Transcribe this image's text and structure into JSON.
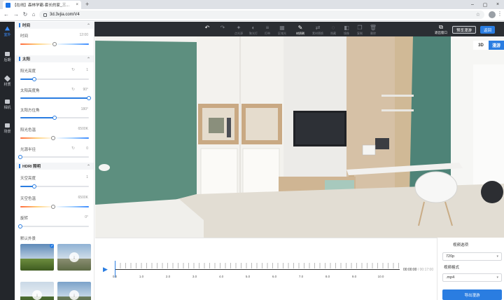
{
  "browser": {
    "tab_title": "【在线】森林学霸-套长的家_三...",
    "url": "3d.3vjia.com/V4",
    "new_tab": "+"
  },
  "sidenav": {
    "items": [
      {
        "label": "室外",
        "icon": "house-icon",
        "active": true
      },
      {
        "label": "后期",
        "icon": "sliders-icon",
        "active": false
      },
      {
        "label": "材质",
        "icon": "cube-icon",
        "active": false
      },
      {
        "label": "相机",
        "icon": "camera-icon",
        "active": false
      },
      {
        "label": "场景",
        "icon": "scene-icon",
        "active": false
      }
    ]
  },
  "panel": {
    "sec_time": "时间",
    "time_label": "时间",
    "time_value": "12:00",
    "time_fraction": 0.5,
    "sec_sun": "太阳",
    "sun_brightness_label": "阳光亮度",
    "sun_brightness_value": "1",
    "sun_brightness_fraction": 0.2,
    "sun_altitude_label": "太阳高度角",
    "sun_altitude_value": "90°",
    "sun_altitude_fraction": 1.0,
    "sun_azimuth_label": "太阳方位角",
    "sun_azimuth_value": "180°",
    "sun_azimuth_fraction": 0.5,
    "sun_color_label": "阳光色温",
    "sun_color_value": "6500K",
    "sun_color_fraction": 0.48,
    "sun_radius_label": "光源半径",
    "sun_radius_value": "0",
    "sun_radius_fraction": 0.0,
    "sec_hdri": "HDRI 照明",
    "sky_brightness_label": "天空亮度",
    "sky_brightness_value": "1",
    "sky_brightness_fraction": 0.2,
    "sky_color_label": "天空色温",
    "sky_color_value": "6500K",
    "sky_color_fraction": 0.48,
    "rotation_label": "旋转",
    "rotation_value": "0°",
    "rotation_fraction": 0.0,
    "default_bg_label": "默认外景"
  },
  "toolbar": {
    "tools": [
      {
        "label": "撤销",
        "icon": "undo-icon",
        "on": true
      },
      {
        "label": "重做",
        "icon": "redo-icon",
        "on": false
      },
      {
        "label": "点光源",
        "icon": "pointlight-icon",
        "on": false
      },
      {
        "label": "聚光灯",
        "icon": "spotlight-icon",
        "on": false
      },
      {
        "label": "灯带",
        "icon": "lightstrip-icon",
        "on": false
      },
      {
        "label": "区域光",
        "icon": "arealight-icon",
        "on": false
      },
      {
        "label": "材质刷",
        "icon": "brush-icon",
        "on": true
      },
      {
        "label": "素材替换",
        "icon": "replace-icon",
        "on": false
      },
      {
        "label": "隐藏",
        "icon": "hide-icon",
        "on": false
      },
      {
        "label": "镜像",
        "icon": "mirror-icon",
        "on": false
      },
      {
        "label": "复制",
        "icon": "copy-icon",
        "on": false
      },
      {
        "label": "删除",
        "icon": "delete-icon",
        "on": false
      }
    ],
    "exit_window": "退出窗口",
    "preview_label": "预览漫游",
    "back_label": "返回"
  },
  "viewport": {
    "mode_3d": "3D",
    "mode_roam": "漫游"
  },
  "timeline": {
    "ticks": [
      "0.0",
      "1.0",
      "2.0",
      "3.0",
      "4.0",
      "5.0",
      "6.0",
      "7.0",
      "8.0",
      "9.0",
      "10.0"
    ],
    "current": "00:00:00",
    "total": "/ 00:17:00"
  },
  "export": {
    "video_option_label": "视频选项",
    "resolution": "720p",
    "format_label": "视频格式",
    "format": ".mp4",
    "export_button": "导出漫游"
  },
  "colors": {
    "accent": "#2a7de1",
    "sidenav_bg": "#23262b",
    "toolbar_bg": "#2b2e33"
  }
}
